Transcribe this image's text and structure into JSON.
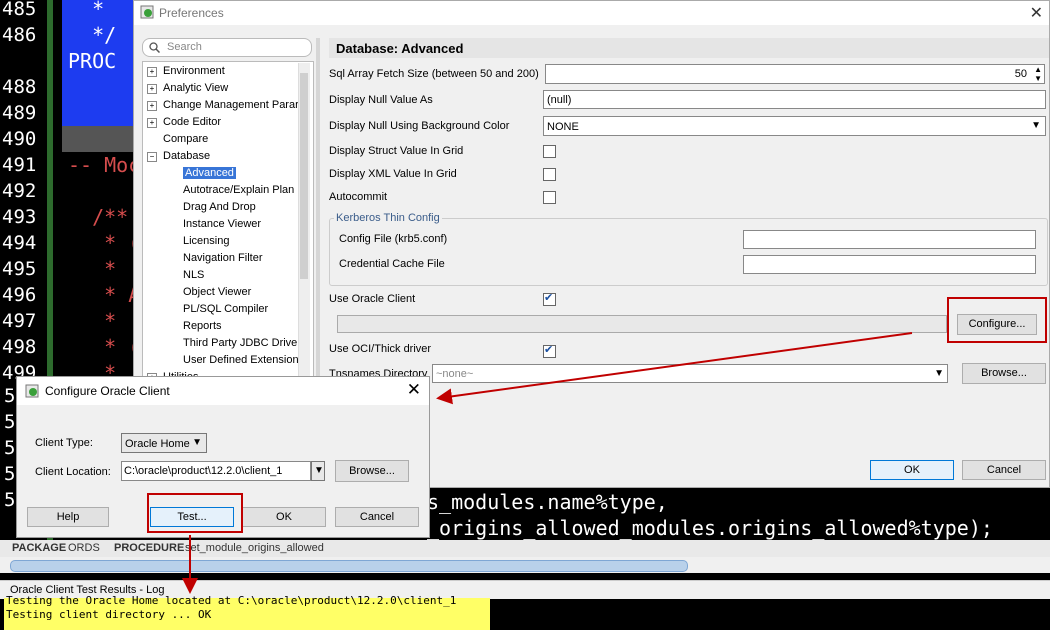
{
  "editor": {
    "line_numbers": [
      "485",
      "486",
      "",
      "488",
      "489",
      "490",
      "491",
      "492",
      "493",
      "494",
      "495",
      "496",
      "497",
      "498",
      "499"
    ],
    "code_lines": [
      "  *",
      "  */",
      "PROC",
      "",
      "",
      "",
      "-- Moc",
      "",
      "  /**",
      "   * (",
      "   *",
      "   * A",
      "   *",
      "   * (",
      "   *"
    ],
    "bottom_line_1": "s_modules.name%type,",
    "bottom_line_2": "_origins_allowed_modules.origins_allowed%type);",
    "gutter_left_digits": [
      "5",
      "5",
      "5",
      "5",
      "5"
    ]
  },
  "breadcrumb": {
    "seg1_kw": "PACKAGE",
    "seg1_name": "ORDS",
    "seg2_kw": "PROCEDURE",
    "seg2_name": "set_module_origins_allowed"
  },
  "log": {
    "title": "Oracle Client Test Results - Log",
    "lines": [
      "Testing the Oracle Home located at C:\\oracle\\product\\12.2.0\\client_1",
      "Testing client directory ... OK"
    ]
  },
  "preferences": {
    "title": "Preferences",
    "search_placeholder": "Search",
    "tree": [
      {
        "label": "Environment",
        "expander": "+"
      },
      {
        "label": "Analytic View",
        "expander": "+"
      },
      {
        "label": "Change Management Parar",
        "expander": "+"
      },
      {
        "label": "Code Editor",
        "expander": "+"
      },
      {
        "label": "Compare",
        "expander": ""
      },
      {
        "label": "Database",
        "expander": "−"
      },
      {
        "label": "Advanced",
        "expander": "",
        "selected": true
      },
      {
        "label": "Autotrace/Explain Plan",
        "expander": ""
      },
      {
        "label": "Drag And Drop",
        "expander": ""
      },
      {
        "label": "Instance Viewer",
        "expander": ""
      },
      {
        "label": "Licensing",
        "expander": ""
      },
      {
        "label": "Navigation Filter",
        "expander": ""
      },
      {
        "label": "NLS",
        "expander": ""
      },
      {
        "label": "Object Viewer",
        "expander": ""
      },
      {
        "label": "PL/SQL Compiler",
        "expander": ""
      },
      {
        "label": "Reports",
        "expander": ""
      },
      {
        "label": "Third Party JDBC Driver",
        "expander": ""
      },
      {
        "label": "User Defined Extension",
        "expander": ""
      },
      {
        "label": "Utilities",
        "expander": "+"
      }
    ],
    "section_title": "Database: Advanced",
    "sql_fetch_label": "Sql Array Fetch Size (between 50 and 200)",
    "sql_fetch_value": "50",
    "null_value_label": "Display Null Value As",
    "null_value_value": "(null)",
    "null_bg_label": "Display Null Using Background Color",
    "null_bg_value": "NONE",
    "struct_label": "Display Struct Value In Grid",
    "struct_checked": false,
    "xml_label": "Display XML Value In Grid",
    "xml_checked": false,
    "autocommit_label": "Autocommit",
    "autocommit_checked": false,
    "kerberos_title": "Kerberos Thin Config",
    "config_file_label": "Config File (krb5.conf)",
    "config_file_value": "",
    "cred_cache_label": "Credential Cache File",
    "cred_cache_value": "",
    "use_client_label": "Use Oracle Client",
    "use_client_checked": true,
    "client_path_value": "",
    "configure_button": "Configure...",
    "oci_label": "Use OCI/Thick driver",
    "oci_checked": true,
    "tns_label": "Tnsnames Directory",
    "tns_value": "~none~",
    "browse_button": "Browse...",
    "ok_button": "OK",
    "cancel_button": "Cancel"
  },
  "configure": {
    "title": "Configure Oracle Client",
    "client_type_label": "Client Type:",
    "client_type_value": "Oracle Home",
    "client_location_label": "Client Location:",
    "client_location_value": "C:\\oracle\\product\\12.2.0\\client_1",
    "browse_button": "Browse...",
    "help_button": "Help",
    "test_button": "Test...",
    "ok_button": "OK",
    "cancel_button": "Cancel"
  },
  "colors": {
    "annotation_red": "#c00000",
    "log_highlight": "#ffff66",
    "editor_blue": "#1d3cf0"
  }
}
